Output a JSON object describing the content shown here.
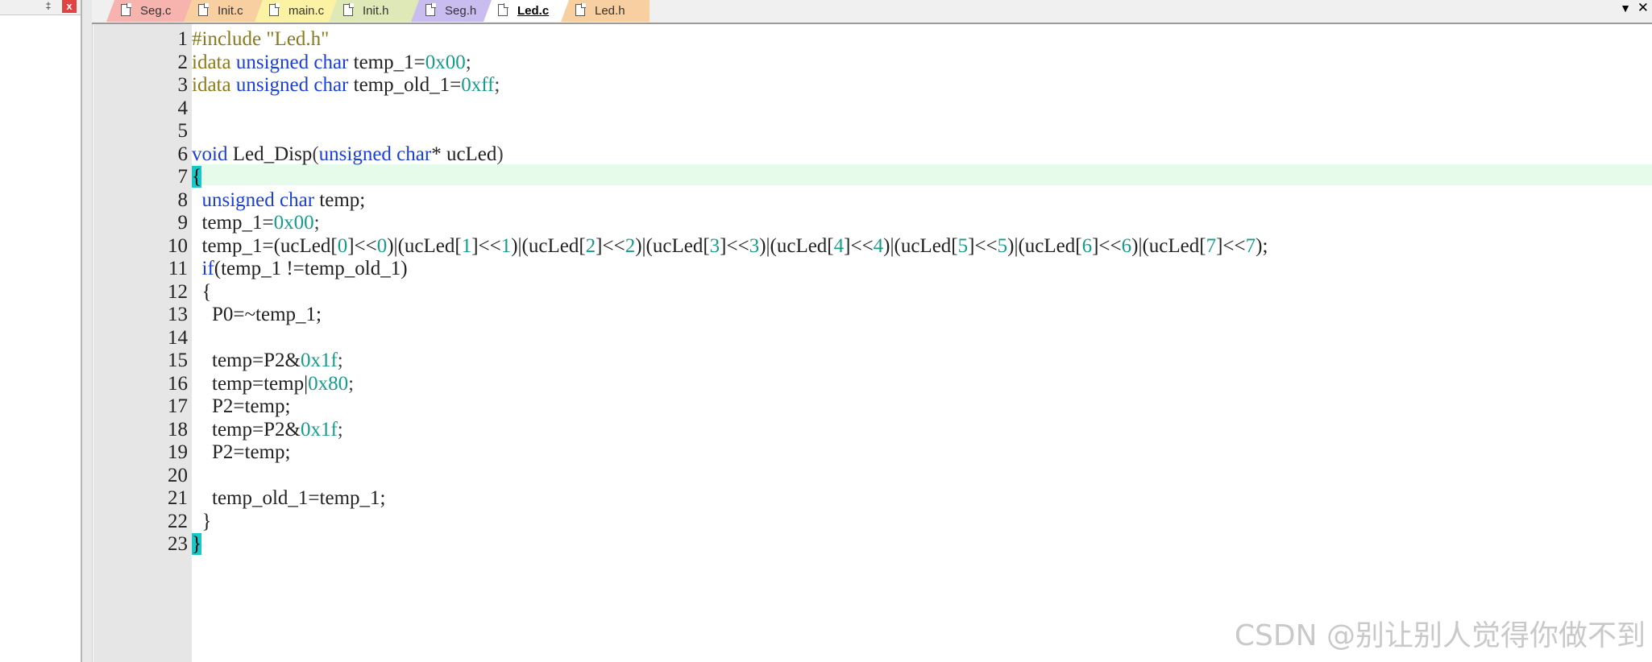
{
  "panel": {
    "pin_glyph": "‡",
    "close_glyph": "x"
  },
  "tabs": [
    {
      "label": "Seg.c",
      "bg": "#f7b4ae",
      "active": false
    },
    {
      "label": "Init.c",
      "bg": "#f8cfa0",
      "active": false
    },
    {
      "label": "main.c",
      "bg": "#fbf2a4",
      "active": false
    },
    {
      "label": "Init.h",
      "bg": "#dfe9b8",
      "active": false
    },
    {
      "label": "Seg.h",
      "bg": "#c9bdf0",
      "active": false
    },
    {
      "label": "Led.c",
      "bg": "#ffffff",
      "active": true
    },
    {
      "label": "Led.h",
      "bg": "#f8cfa0",
      "active": false
    }
  ],
  "tabbar": {
    "menu_glyph": "▼",
    "close_glyph": "✕"
  },
  "editor": {
    "current_line": 7,
    "lines": [
      [
        [
          "pp",
          "#include "
        ],
        [
          "str",
          "\"Led.h\""
        ]
      ],
      [
        [
          "pp",
          "idata "
        ],
        [
          "kw",
          "unsigned char "
        ],
        [
          "id",
          "temp_1="
        ],
        [
          "num",
          "0x00"
        ],
        [
          "punc",
          ";"
        ]
      ],
      [
        [
          "pp",
          "idata "
        ],
        [
          "kw",
          "unsigned char "
        ],
        [
          "id",
          "temp_old_1="
        ],
        [
          "num",
          "0xff"
        ],
        [
          "punc",
          ";"
        ]
      ],
      [],
      [],
      [
        [
          "kw",
          "void "
        ],
        [
          "id",
          "Led_Disp"
        ],
        [
          "punc",
          "("
        ],
        [
          "kw",
          "unsigned char"
        ],
        [
          "id",
          "* ucLed"
        ],
        [
          "punc",
          ")"
        ]
      ],
      [
        [
          "brace",
          "{"
        ]
      ],
      [
        [
          "id",
          "  "
        ],
        [
          "kw",
          "unsigned char "
        ],
        [
          "id",
          "temp;"
        ]
      ],
      [
        [
          "id",
          "  temp_1="
        ],
        [
          "num",
          "0x00"
        ],
        [
          "punc",
          ";"
        ]
      ],
      [
        [
          "id",
          "  temp_1=(ucLed["
        ],
        [
          "num",
          "0"
        ],
        [
          "id",
          "]<<"
        ],
        [
          "num",
          "0"
        ],
        [
          "id",
          ")|(ucLed["
        ],
        [
          "num",
          "1"
        ],
        [
          "id",
          "]<<"
        ],
        [
          "num",
          "1"
        ],
        [
          "id",
          ")|(ucLed["
        ],
        [
          "num",
          "2"
        ],
        [
          "id",
          "]<<"
        ],
        [
          "num",
          "2"
        ],
        [
          "id",
          ")|(ucLed["
        ],
        [
          "num",
          "3"
        ],
        [
          "id",
          "]<<"
        ],
        [
          "num",
          "3"
        ],
        [
          "id",
          ")|(ucLed["
        ],
        [
          "num",
          "4"
        ],
        [
          "id",
          "]<<"
        ],
        [
          "num",
          "4"
        ],
        [
          "id",
          ")|(ucLed["
        ],
        [
          "num",
          "5"
        ],
        [
          "id",
          "]<<"
        ],
        [
          "num",
          "5"
        ],
        [
          "id",
          ")|(ucLed["
        ],
        [
          "num",
          "6"
        ],
        [
          "id",
          "]<<"
        ],
        [
          "num",
          "6"
        ],
        [
          "id",
          ")|(ucLed["
        ],
        [
          "num",
          "7"
        ],
        [
          "id",
          "]<<"
        ],
        [
          "num",
          "7"
        ],
        [
          "id",
          ");"
        ]
      ],
      [
        [
          "id",
          "  "
        ],
        [
          "kw",
          "if"
        ],
        [
          "id",
          "(temp_1 !=temp_old_1)"
        ]
      ],
      [
        [
          "id",
          "  {"
        ]
      ],
      [
        [
          "id",
          "    P0=~temp_1;"
        ]
      ],
      [],
      [
        [
          "id",
          "    temp=P2&"
        ],
        [
          "num",
          "0x1f"
        ],
        [
          "punc",
          ";"
        ]
      ],
      [
        [
          "id",
          "    temp=temp|"
        ],
        [
          "num",
          "0x80"
        ],
        [
          "punc",
          ";"
        ]
      ],
      [
        [
          "id",
          "    P2=temp;"
        ]
      ],
      [
        [
          "id",
          "    temp=P2&"
        ],
        [
          "num",
          "0x1f"
        ],
        [
          "punc",
          ";"
        ]
      ],
      [
        [
          "id",
          "    P2=temp;"
        ]
      ],
      [],
      [
        [
          "id",
          "    temp_old_1=temp_1;"
        ]
      ],
      [
        [
          "id",
          "  }"
        ]
      ],
      [
        [
          "brace",
          "}"
        ]
      ]
    ]
  },
  "watermark": "CSDN @别让别人觉得你做不到"
}
